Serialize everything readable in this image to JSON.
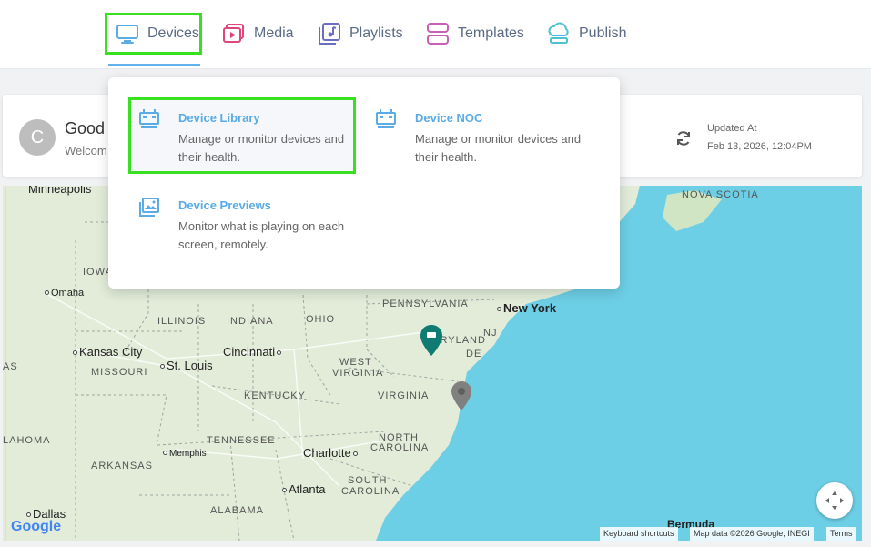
{
  "nav": {
    "devices": "Devices",
    "media": "Media",
    "playlists": "Playlists",
    "templates": "Templates",
    "publish": "Publish",
    "active_color": "#63b3ee"
  },
  "dropdown": {
    "items": [
      {
        "title": "Device Library",
        "desc": "Manage or monitor devices and their health.",
        "icon": "device-library-icon"
      },
      {
        "title": "Device NOC",
        "desc": "Manage or monitor devices and their health.",
        "icon": "device-noc-icon"
      },
      {
        "title": "Device Previews",
        "desc": "Monitor what is playing on each screen, remotely.",
        "icon": "device-previews-icon"
      }
    ]
  },
  "card": {
    "avatar_letter": "C",
    "title": "Good",
    "subtitle": "Welcom",
    "updated_label": "Updated At",
    "updated_value": "Feb 13, 2026, 12:04PM"
  },
  "map": {
    "labels": {
      "minneapolis": "Minneapolis",
      "iowa": "IOWA",
      "omaha": "Omaha",
      "illinois": "ILLINOIS",
      "indiana": "INDIANA",
      "ohio": "OHIO",
      "pennsylvania": "PENNSYLVANIA",
      "new_york": "New York",
      "nova_scotia": "NOVA SCOTIA",
      "kansas_city": "Kansas City",
      "cincinnati": "Cincinnati",
      "maryland": "MARYLAND",
      "nj": "NJ",
      "de": "DE",
      "as": "AS",
      "missouri": "MISSOURI",
      "st_louis": "St. Louis",
      "west_virginia_1": "WEST",
      "west_virginia_2": "VIRGINIA",
      "kentucky": "KENTUCKY",
      "virginia": "VIRGINIA",
      "tennessee": "TENNESSEE",
      "lahoma": "LAHOMA",
      "north_carolina_1": "NORTH",
      "north_carolina_2": "CAROLINA",
      "memphis": "Memphis",
      "charlotte": "Charlotte",
      "arkansas": "ARKANSAS",
      "south_carolina_1": "SOUTH",
      "south_carolina_2": "CAROLINA",
      "atlanta": "Atlanta",
      "alabama": "ALABAMA",
      "dallas": "Dallas",
      "bermuda": "Bermuda"
    },
    "google": "Google",
    "attr_keyboard": "Keyboard shortcuts",
    "attr_data": "Map data ©2026 Google, INEGI",
    "attr_terms": "Terms",
    "water_color": "#6dcfe6",
    "land_color": "#e2ecd9"
  }
}
